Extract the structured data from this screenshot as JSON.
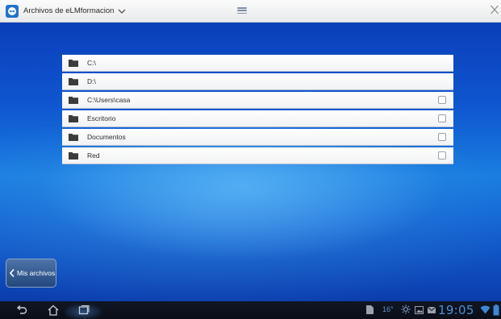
{
  "window": {
    "title": "Archivos de eLMformacion",
    "colors": {
      "accent": "#1f73c9",
      "desktop": "#1465d1"
    }
  },
  "files": [
    {
      "name": "C:\\",
      "icon": "folder-icon",
      "checkbox": false
    },
    {
      "name": "D:\\",
      "icon": "folder-icon",
      "checkbox": false
    },
    {
      "name": "C:\\Users\\casa",
      "icon": "folder-icon",
      "checkbox": true
    },
    {
      "name": "Escritorio",
      "icon": "folder-icon",
      "checkbox": true
    },
    {
      "name": "Documentos",
      "icon": "folder-icon",
      "checkbox": true
    },
    {
      "name": "Red",
      "icon": "folder-icon",
      "checkbox": true
    }
  ],
  "sidebar": {
    "mis_archivos_label": "Mis archivos"
  },
  "statusbar": {
    "temperature": "16°",
    "clock": "19:05"
  }
}
